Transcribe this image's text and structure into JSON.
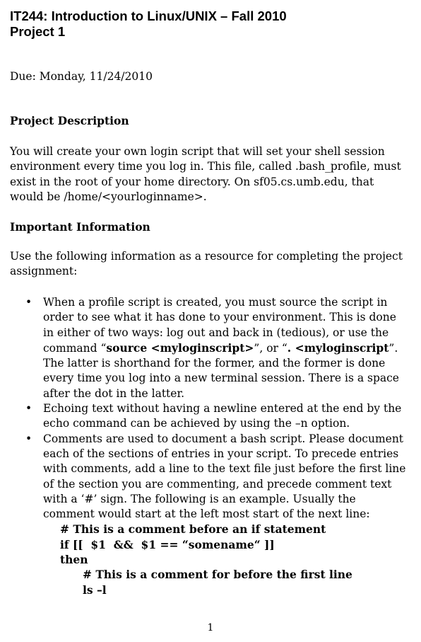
{
  "document": {
    "title_line1": "IT244:  Introduction to Linux/UNIX – Fall 2010",
    "title_line2": "Project 1",
    "due": "Due: Monday, 11/24/2010",
    "section1_heading": "Project Description",
    "section1_para": "You will create your own login script that will set your shell session environment every time you log in.  This file, called .bash_profile, must exist in the root of your home directory.  On sf05.cs.umb.edu, that would be /home/<yourloginname>.",
    "section2_heading": "Important Information",
    "section2_intro": "Use the following information as a resource for completing the project assignment:",
    "bullet_symbol": "•",
    "bullet1": {
      "text_a": "When a profile script is created, you must source the script in order to see what it has done to your environment.  This is done in either of two ways:  log out and back in (tedious), or use the command “",
      "bold_a": "source <myloginscript>",
      "text_b": "”, or “",
      "bold_b": ". <myloginscript",
      "text_c": "”.  The latter is shorthand for the former, and the former is done every time you log into a new terminal session. There is a space after the dot in the latter."
    },
    "bullet2": "Echoing text without having a newline entered at the end by the echo command can be achieved by using the –n option.",
    "bullet3": "Comments are used to document a bash script.  Please document each of the sections of entries in your script.  To precede entries with comments, add a line to the text file just before the first line of the section you are commenting, and precede comment text with a ‘#’ sign.  The following is an example.  Usually the comment would start at the left most start of the next line:",
    "code": [
      "# This is a comment before an if statement",
      "if [[  $1  &&  $1 == “somename“ ]]",
      "then",
      "# This is a comment for before the first line",
      "ls –l"
    ],
    "page_number": "1"
  }
}
